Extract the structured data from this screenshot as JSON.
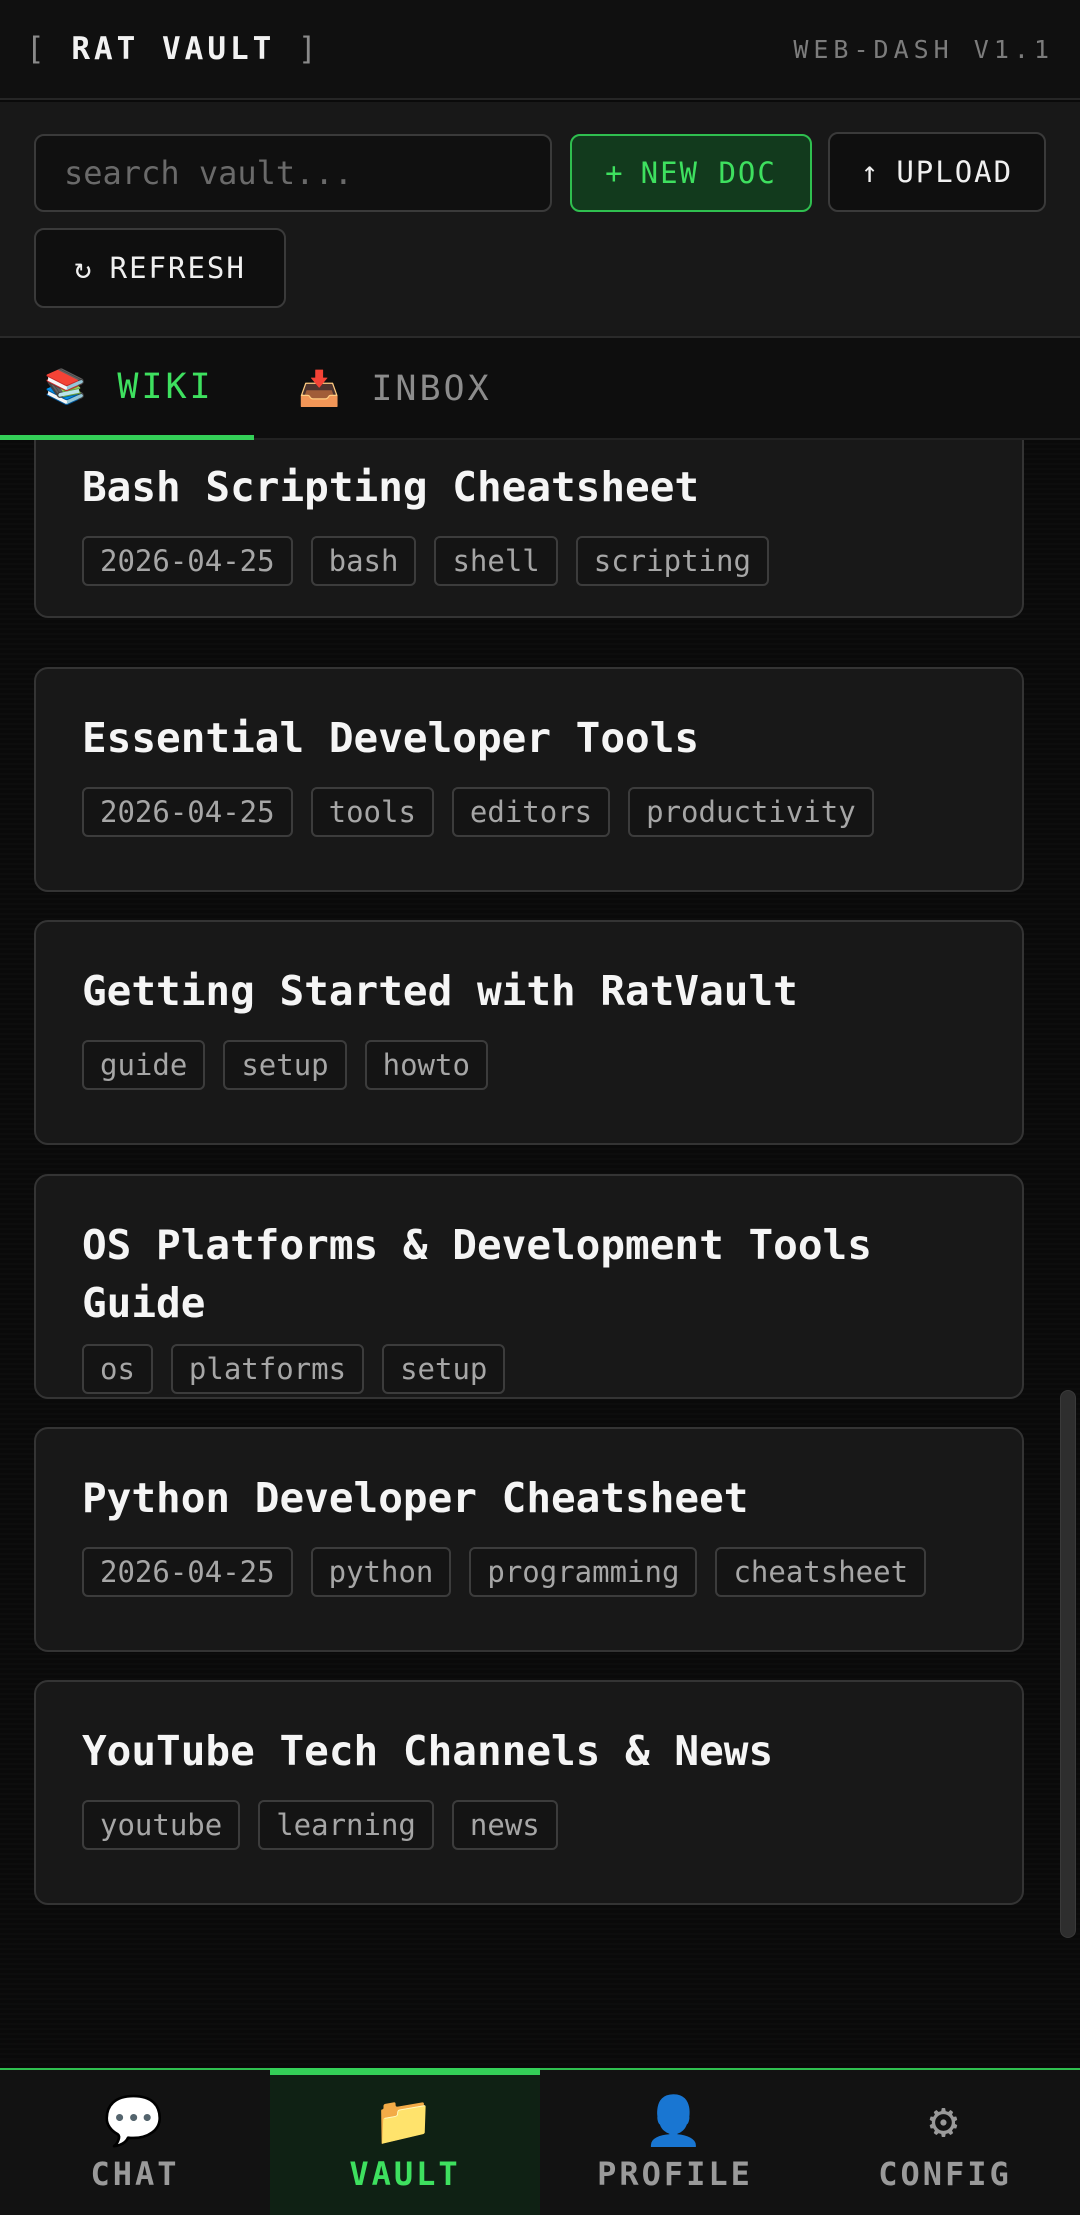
{
  "header": {
    "brand_open": "[",
    "brand": "RAT VAULT",
    "brand_close": "]",
    "version": "WEB-DASH V1.1"
  },
  "toolbar": {
    "search_placeholder": "search vault...",
    "new_doc_icon": "+",
    "new_doc_label": "NEW DOC",
    "upload_icon": "↑",
    "upload_label": "UPLOAD",
    "refresh_icon": "↻",
    "refresh_label": "REFRESH"
  },
  "tabs": [
    {
      "icon": "📚",
      "label": "WIKI",
      "active": true
    },
    {
      "icon": "📥",
      "label": "INBOX",
      "active": false
    }
  ],
  "documents": [
    {
      "title": "Bash Scripting Cheatsheet",
      "tags": [
        "2026-04-25",
        "bash",
        "shell",
        "scripting"
      ]
    },
    {
      "title": "Essential Developer Tools",
      "tags": [
        "2026-04-25",
        "tools",
        "editors",
        "productivity"
      ]
    },
    {
      "title": "Getting Started with RatVault",
      "tags": [
        "guide",
        "setup",
        "howto"
      ]
    },
    {
      "title": "OS Platforms & Development Tools Guide",
      "title_line1": "OS Platforms & Development Tools",
      "title_line2": "Guide",
      "tags": [
        "os",
        "platforms",
        "setup"
      ]
    },
    {
      "title": "Python Developer Cheatsheet",
      "tags": [
        "2026-04-25",
        "python",
        "programming",
        "cheatsheet"
      ]
    },
    {
      "title": "YouTube Tech Channels & News",
      "tags": [
        "youtube",
        "learning",
        "news"
      ]
    }
  ],
  "bottom_nav": [
    {
      "icon": "💬",
      "label": "CHAT",
      "active": false
    },
    {
      "icon": "📁",
      "label": "VAULT",
      "active": true
    },
    {
      "icon": "👤",
      "label": "PROFILE",
      "active": false
    },
    {
      "icon": "⚙",
      "label": "CONFIG",
      "active": false
    }
  ],
  "colors": {
    "accent": "#3ee05f",
    "background": "#0a0a0a",
    "card": "#181818",
    "border": "#343434"
  }
}
